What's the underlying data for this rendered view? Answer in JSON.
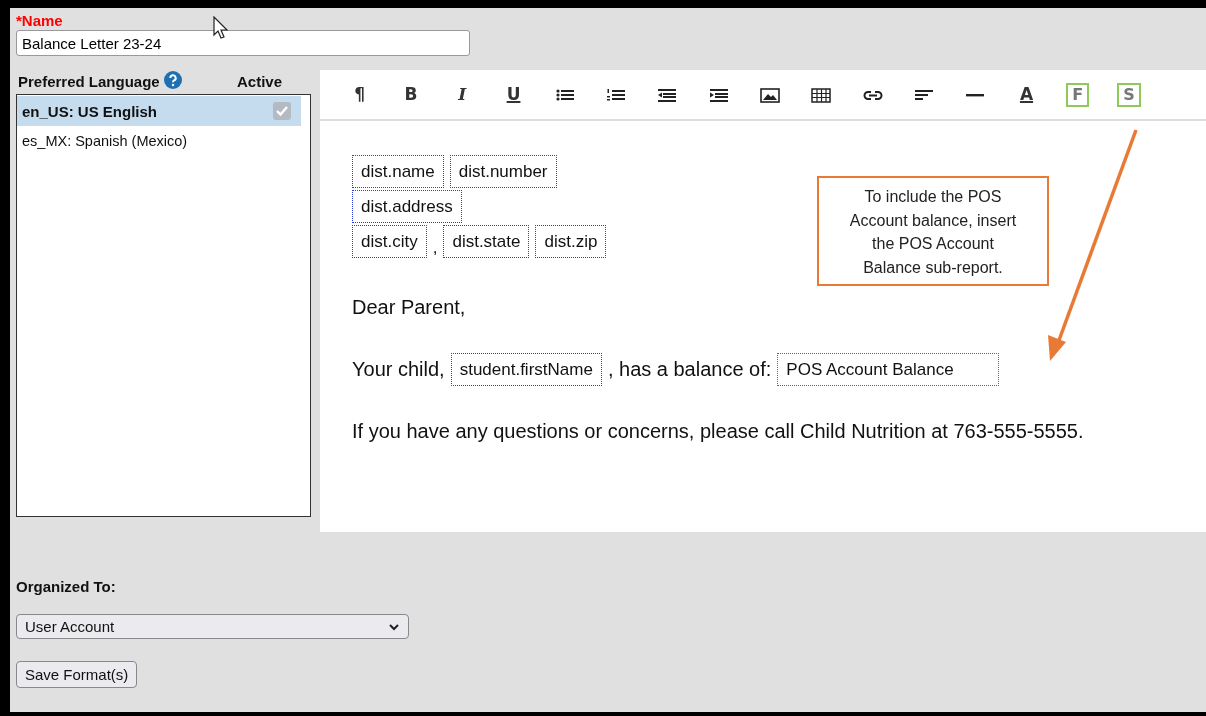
{
  "name_field": {
    "label": "*Name",
    "value": "Balance Letter 23-24"
  },
  "languages": {
    "header": "Preferred Language",
    "active_header": "Active",
    "items": [
      {
        "label": "en_US: US English",
        "selected": true,
        "active": true
      },
      {
        "label": "es_MX: Spanish (Mexico)",
        "selected": false,
        "active": false
      }
    ]
  },
  "toolbar": [
    {
      "kind": "plain",
      "label": "¶"
    },
    {
      "kind": "bold",
      "label": "B"
    },
    {
      "kind": "italic",
      "label": "I"
    },
    {
      "kind": "underline",
      "label": "U"
    },
    {
      "kind": "bullet-list"
    },
    {
      "kind": "numbered-list"
    },
    {
      "kind": "outdent"
    },
    {
      "kind": "indent"
    },
    {
      "kind": "image"
    },
    {
      "kind": "table"
    },
    {
      "kind": "link"
    },
    {
      "kind": "align"
    },
    {
      "kind": "rule"
    },
    {
      "kind": "font-color",
      "label": "A"
    },
    {
      "kind": "boxed",
      "label": "F"
    },
    {
      "kind": "boxed",
      "label": "S"
    }
  ],
  "document": {
    "address_rows": [
      [
        {
          "kind": "field",
          "text": "dist.name"
        },
        {
          "kind": "field",
          "text": "dist.number"
        }
      ],
      [
        {
          "kind": "field",
          "text": "dist.address"
        }
      ],
      [
        {
          "kind": "field",
          "text": "dist.city"
        },
        {
          "kind": "text",
          "text": ","
        },
        {
          "kind": "field",
          "text": "dist.state"
        },
        {
          "kind": "field",
          "text": "dist.zip"
        }
      ]
    ],
    "paragraphs": [
      [
        {
          "kind": "text",
          "text": "Dear Parent,"
        }
      ],
      [
        {
          "kind": "text",
          "text": "Your child,"
        },
        {
          "kind": "field",
          "text": "student.firstName"
        },
        {
          "kind": "text",
          "text": ", has a balance of:"
        },
        {
          "kind": "subreport",
          "text": "POS Account Balance"
        }
      ],
      [
        {
          "kind": "text",
          "text": "If you have any questions or concerns, please call Child Nutrition at 763-555-5555."
        }
      ]
    ]
  },
  "callout": {
    "text": "To include the POS Account balance, insert the POS Account Balance sub-report."
  },
  "organized_to": {
    "label": "Organized To:",
    "value": "User Account"
  },
  "save_button": {
    "label": "Save Format(s)"
  }
}
